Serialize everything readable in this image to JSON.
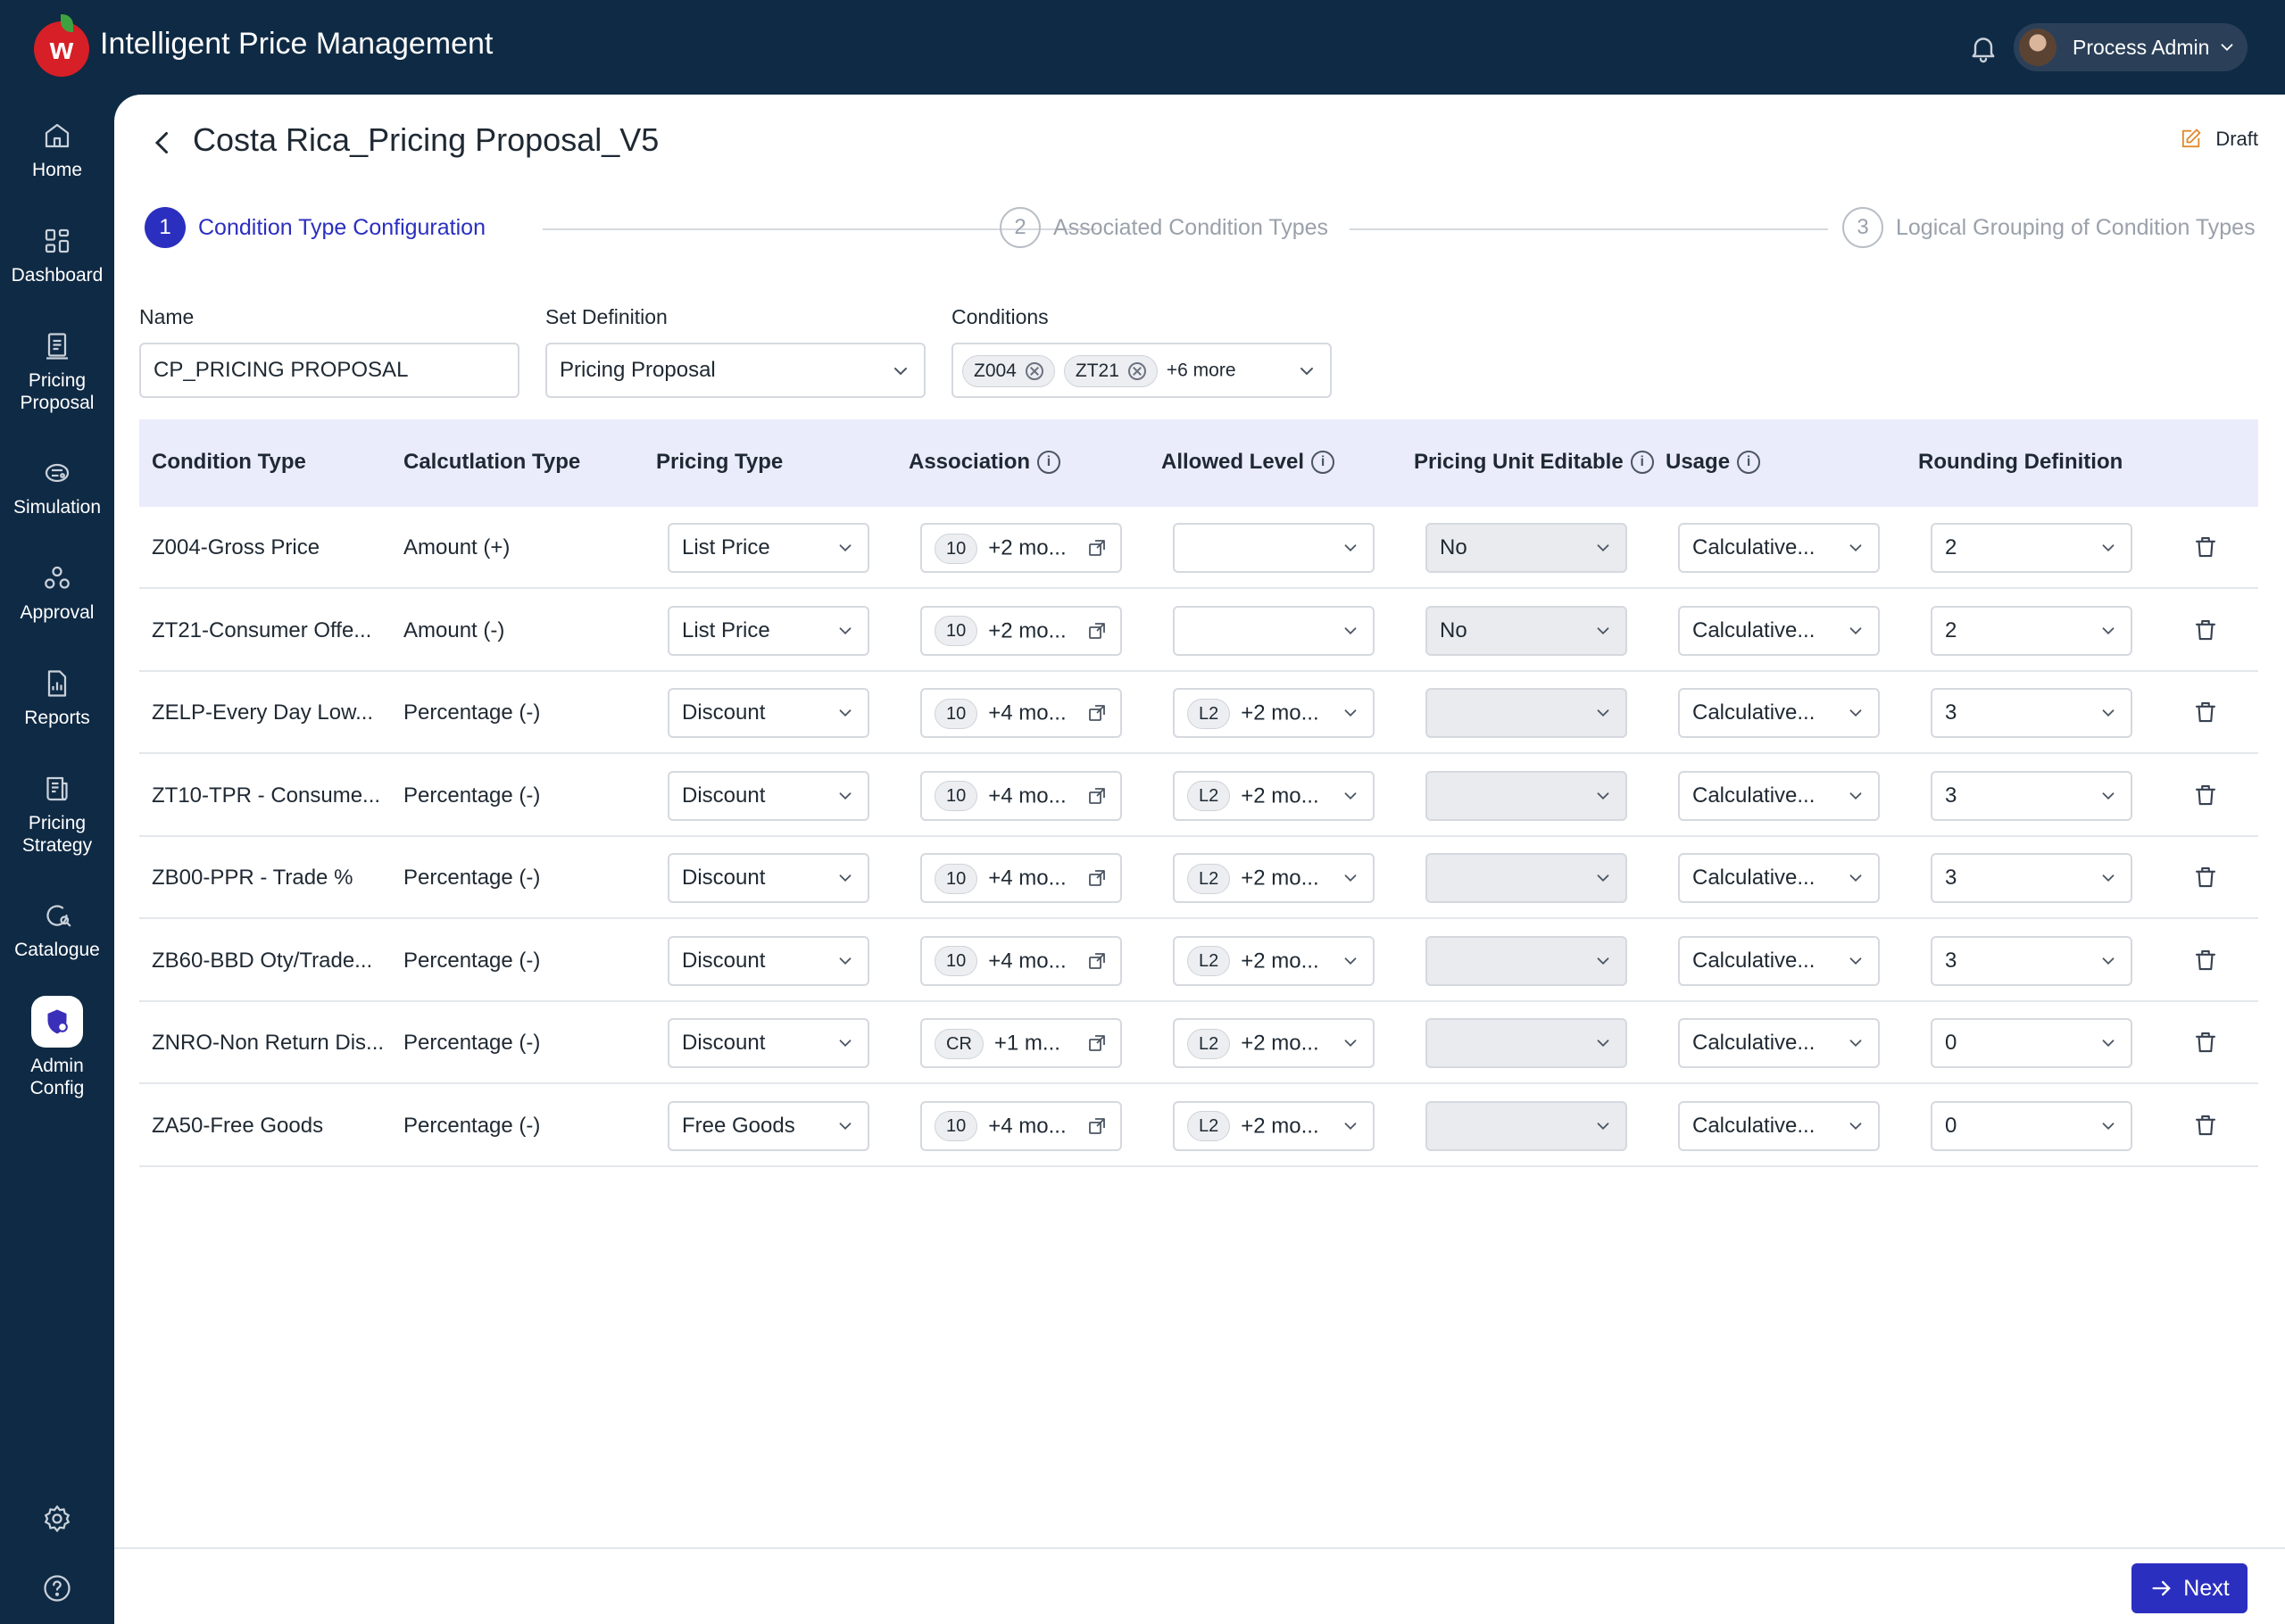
{
  "app": {
    "title": "Intelligent Price Management",
    "logo_letter": "w"
  },
  "user": {
    "name": "Process Admin"
  },
  "sidebar": {
    "items": [
      {
        "label_lines": [
          "Home"
        ],
        "icon": "home-icon"
      },
      {
        "label_lines": [
          "Dashboard"
        ],
        "icon": "dashboard-icon"
      },
      {
        "label_lines": [
          "Pricing",
          "Proposal"
        ],
        "icon": "document-icon"
      },
      {
        "label_lines": [
          "Simulation"
        ],
        "icon": "simulation-icon"
      },
      {
        "label_lines": [
          "Approval"
        ],
        "icon": "approval-icon"
      },
      {
        "label_lines": [
          "Reports"
        ],
        "icon": "reports-icon"
      },
      {
        "label_lines": [
          "Pricing",
          "Strategy"
        ],
        "icon": "strategy-icon"
      },
      {
        "label_lines": [
          "Catalogue"
        ],
        "icon": "catalogue-icon"
      },
      {
        "label_lines": [
          "Admin",
          "Config"
        ],
        "icon": "admin-config-icon",
        "active": true
      }
    ],
    "bottom": [
      "settings-icon",
      "help-icon"
    ]
  },
  "page": {
    "title": "Costa Rica_Pricing Proposal_V5",
    "status": "Draft"
  },
  "stepper": [
    {
      "num": "1",
      "label": "Condition Type Configuration",
      "active": true
    },
    {
      "num": "2",
      "label": "Associated Condition Types",
      "active": false
    },
    {
      "num": "3",
      "label": "Logical Grouping of Condition Types",
      "active": false
    }
  ],
  "form": {
    "name_label": "Name",
    "name_value": "CP_PRICING PROPOSAL",
    "set_def_label": "Set Definition",
    "set_def_value": "Pricing Proposal",
    "conditions_label": "Conditions",
    "conditions_chips": [
      "Z004",
      "ZT21"
    ],
    "conditions_more": "+6 more"
  },
  "table": {
    "headers": {
      "condition_type": "Condition Type",
      "calc_type": "Calcutlation Type",
      "pricing_type": "Pricing Type",
      "association": "Association",
      "allowed_level": "Allowed Level",
      "pricing_unit_editable": "Pricing Unit Editable",
      "usage": "Usage",
      "rounding": "Rounding Definition",
      "info_glyph": "i"
    },
    "rows": [
      {
        "condition_type": "Z004-Gross Price",
        "calc_type": "Amount (+)",
        "pricing_type": "List Price",
        "assoc_chip": "10",
        "assoc_more": "+2 mo...",
        "level_chip": "",
        "level_more": "",
        "pue": "No",
        "usage": "Calculative...",
        "rounding": "2"
      },
      {
        "condition_type": "ZT21-Consumer Offe...",
        "calc_type": "Amount (-)",
        "pricing_type": "List Price",
        "assoc_chip": "10",
        "assoc_more": "+2 mo...",
        "level_chip": "",
        "level_more": "",
        "pue": "No",
        "usage": "Calculative...",
        "rounding": "2"
      },
      {
        "condition_type": "ZELP-Every Day Low...",
        "calc_type": "Percentage (-)",
        "pricing_type": "Discount",
        "assoc_chip": "10",
        "assoc_more": "+4 mo...",
        "level_chip": "L2",
        "level_more": "+2 mo...",
        "pue": "",
        "usage": "Calculative...",
        "rounding": "3"
      },
      {
        "condition_type": "ZT10-TPR - Consume...",
        "calc_type": "Percentage (-)",
        "pricing_type": "Discount",
        "assoc_chip": "10",
        "assoc_more": "+4 mo...",
        "level_chip": "L2",
        "level_more": "+2 mo...",
        "pue": "",
        "usage": "Calculative...",
        "rounding": "3"
      },
      {
        "condition_type": "ZB00-PPR - Trade %",
        "calc_type": "Percentage (-)",
        "pricing_type": "Discount",
        "assoc_chip": "10",
        "assoc_more": "+4 mo...",
        "level_chip": "L2",
        "level_more": "+2 mo...",
        "pue": "",
        "usage": "Calculative...",
        "rounding": "3"
      },
      {
        "condition_type": "ZB60-BBD Oty/Trade...",
        "calc_type": "Percentage (-)",
        "pricing_type": "Discount",
        "assoc_chip": "10",
        "assoc_more": "+4 mo...",
        "level_chip": "L2",
        "level_more": "+2 mo...",
        "pue": "",
        "usage": "Calculative...",
        "rounding": "3"
      },
      {
        "condition_type": "ZNRO-Non Return Dis...",
        "calc_type": "Percentage (-)",
        "pricing_type": "Discount",
        "assoc_chip": "CR",
        "assoc_more": "+1 m...",
        "level_chip": "L2",
        "level_more": "+2 mo...",
        "pue": "",
        "usage": "Calculative...",
        "rounding": "0"
      },
      {
        "condition_type": "ZA50-Free Goods",
        "calc_type": "Percentage (-)",
        "pricing_type": "Free Goods",
        "assoc_chip": "10",
        "assoc_more": "+4 mo...",
        "level_chip": "L2",
        "level_more": "+2 mo...",
        "pue": "",
        "usage": "Calculative...",
        "rounding": "0"
      }
    ]
  },
  "footer": {
    "next_label": "Next"
  },
  "colors": {
    "navy": "#0f2a44",
    "accent": "#2b2fbf",
    "header_bg": "#ebecfb",
    "logo_red": "#d61f26"
  }
}
